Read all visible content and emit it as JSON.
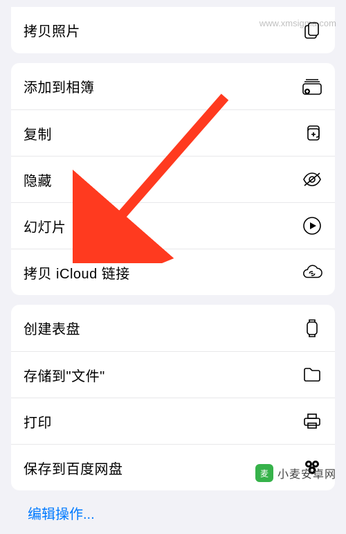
{
  "groups": [
    {
      "items": [
        {
          "label": "拷贝照片",
          "icon": "copy-photo-icon"
        }
      ]
    },
    {
      "items": [
        {
          "label": "添加到相簿",
          "icon": "add-to-album-icon"
        },
        {
          "label": "复制",
          "icon": "duplicate-icon"
        },
        {
          "label": "隐藏",
          "icon": "hide-icon"
        },
        {
          "label": "幻灯片",
          "icon": "slideshow-icon"
        },
        {
          "label": "拷贝 iCloud 链接",
          "icon": "icloud-link-icon"
        }
      ]
    },
    {
      "items": [
        {
          "label": "创建表盘",
          "icon": "watch-face-icon"
        },
        {
          "label": "存储到\"文件\"",
          "icon": "save-to-files-icon"
        },
        {
          "label": "打印",
          "icon": "print-icon"
        },
        {
          "label": "保存到百度网盘",
          "icon": "baidu-pan-icon"
        }
      ]
    }
  ],
  "editActions": "编辑操作...",
  "watermark": {
    "top": "www.xmsigma.com",
    "bottomText": "小麦安卓网",
    "bottomLogoGlyph": "麦"
  },
  "annotation": {
    "arrowColor": "#ff3a1f"
  }
}
